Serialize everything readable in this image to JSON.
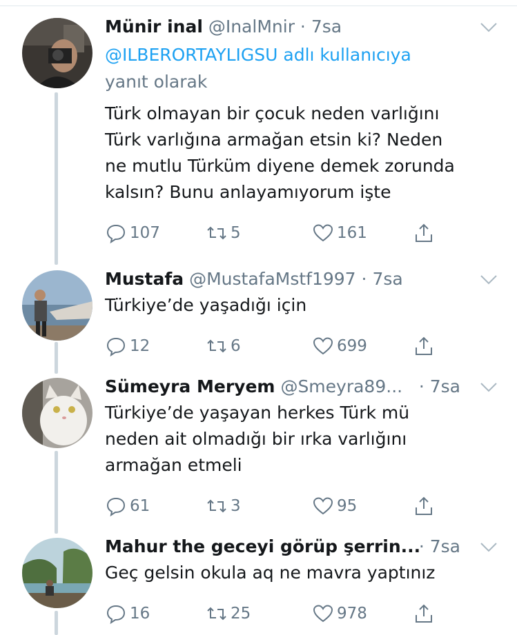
{
  "tweets": [
    {
      "display_name": "Münir inal",
      "handle": "@InalMnir",
      "time": "7sa",
      "reply_to_handle": "@ILBERORTAYLIGSU",
      "reply_to_suffix": " adlı kullanıcıya",
      "reply_to_line2": "yanıt olarak",
      "text_lines": [
        "Türk olmayan bir çocuk neden varlığını",
        "Türk varlığına armağan etsin ki? Neden",
        "ne mutlu Türküm diyene demek zorunda",
        "kalsın? Bunu anlayamıyorum işte"
      ],
      "replies": "107",
      "retweets": "5",
      "likes": "161"
    },
    {
      "display_name": "Mustafa",
      "handle": "@MustafaMstf1997",
      "time": "7sa",
      "text_lines": [
        "Türkiye’de yaşadığı için"
      ],
      "replies": "12",
      "retweets": "6",
      "likes": "699"
    },
    {
      "display_name": "Sümeyra Meryem",
      "handle": "@Smeyra89...",
      "time": "7sa",
      "text_lines": [
        "Türkiye’de yaşayan herkes Türk mü",
        "neden ait olmadığı bir ırka varlığını",
        "armağan etmeli"
      ],
      "replies": "61",
      "retweets": "3",
      "likes": "95"
    },
    {
      "display_name": "Mahur the geceyi görüp şerrin...",
      "handle": "",
      "time": "7sa",
      "text_lines": [
        "Geç gelsin okula aq ne mavra yaptınız"
      ],
      "replies": "16",
      "retweets": "25",
      "likes": "978"
    }
  ],
  "separator": "·",
  "icons": {
    "reply": "reply-icon",
    "retweet": "retweet-icon",
    "like": "heart-icon",
    "share": "share-icon",
    "menu": "chevron-down-icon"
  },
  "colors": {
    "link": "#1da1f2",
    "secondary_text": "#657786",
    "thread_line": "#ccd6dd"
  }
}
